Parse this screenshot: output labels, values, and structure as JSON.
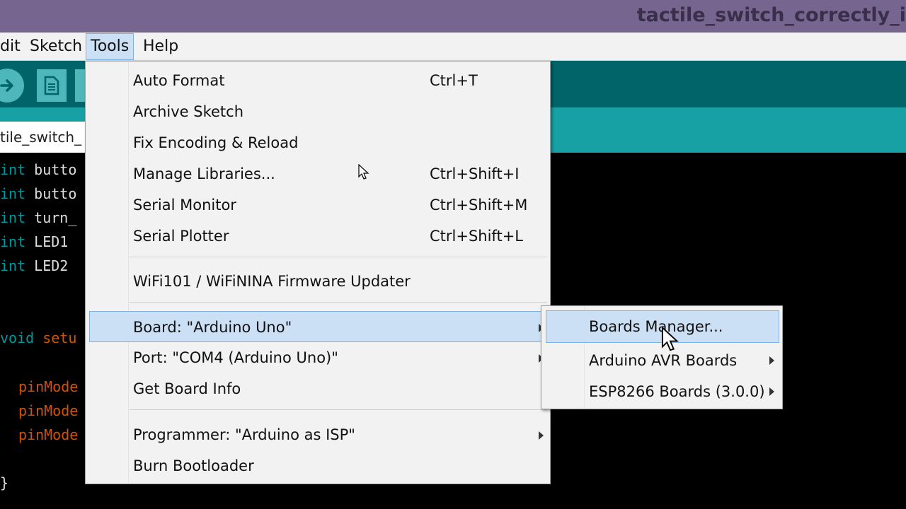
{
  "window": {
    "title": "tactile_switch_correctly_i"
  },
  "menubar": {
    "items": [
      {
        "label": "dit"
      },
      {
        "label": "Sketch"
      },
      {
        "label": "Tools"
      },
      {
        "label": "Help"
      }
    ]
  },
  "toolbar": {
    "buttons": [
      {
        "icon": "verify-arrow-icon"
      },
      {
        "icon": "new-sketch-icon"
      },
      {
        "icon": "open-sketch-icon"
      }
    ]
  },
  "tab": {
    "label": "tile_switch_"
  },
  "editor": {
    "lines": [
      {
        "kw": "int",
        "rest": " butto"
      },
      {
        "kw": "int",
        "rest": " butto"
      },
      {
        "kw": "int",
        "rest": " turn_"
      },
      {
        "kw": "int",
        "rest": " LED1"
      },
      {
        "kw": "int",
        "rest": " LED2"
      },
      {
        "kw": "void",
        "rest": " setu"
      },
      {
        "fn": "pinMode"
      },
      {
        "fn": "pinMode"
      },
      {
        "fn": "pinMode"
      },
      {
        "plain": "}"
      }
    ]
  },
  "tools_menu": {
    "items": [
      {
        "label": "Auto Format",
        "shortcut": "Ctrl+T"
      },
      {
        "label": "Archive Sketch",
        "shortcut": ""
      },
      {
        "label": "Fix Encoding & Reload",
        "shortcut": ""
      },
      {
        "label": "Manage Libraries...",
        "shortcut": "Ctrl+Shift+I"
      },
      {
        "label": "Serial Monitor",
        "shortcut": "Ctrl+Shift+M"
      },
      {
        "label": "Serial Plotter",
        "shortcut": "Ctrl+Shift+L"
      },
      {
        "label": "WiFi101 / WiFiNINA Firmware Updater",
        "shortcut": ""
      },
      {
        "label": "Board: \"Arduino Uno\"",
        "shortcut": ""
      },
      {
        "label": "Port: \"COM4 (Arduino Uno)\"",
        "shortcut": ""
      },
      {
        "label": "Get Board Info",
        "shortcut": ""
      },
      {
        "label": "Programmer: \"Arduino as ISP\"",
        "shortcut": ""
      },
      {
        "label": "Burn Bootloader",
        "shortcut": ""
      }
    ]
  },
  "board_submenu": {
    "items": [
      {
        "label": "Boards Manager..."
      },
      {
        "label": "Arduino AVR Boards"
      },
      {
        "label": "ESP8266 Boards (3.0.0)"
      }
    ]
  },
  "colors": {
    "titlebar": "#76658f",
    "toolbar": "#006468",
    "tabstrip": "#17a1a5",
    "highlight": "#cce0f5",
    "keyword": "#00979c",
    "function": "#d35400"
  }
}
